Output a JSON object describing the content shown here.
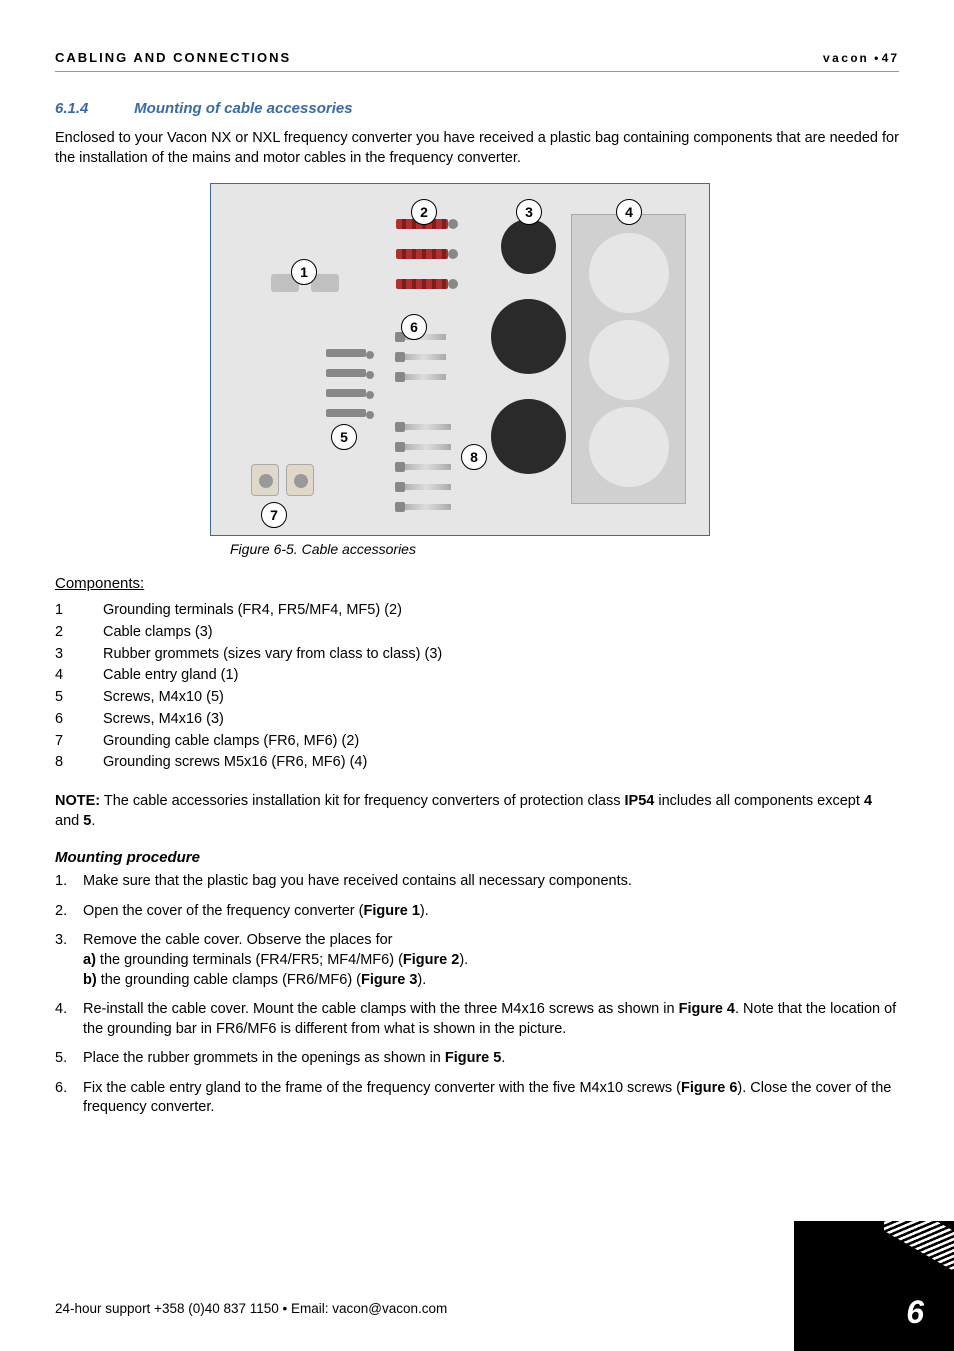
{
  "header": {
    "left": "CABLING AND CONNECTIONS",
    "right_brand": "vacon",
    "right_page": "47"
  },
  "section": {
    "number": "6.1.4",
    "title": "Mounting of cable accessories"
  },
  "intro": "Enclosed to your Vacon NX or NXL frequency converter you have received a plastic bag containing components that are needed for the installation of the mains and motor cables in the frequency converter.",
  "figure": {
    "caption": "Figure 6-5. Cable accessories",
    "callouts": [
      "1",
      "2",
      "3",
      "4",
      "5",
      "6",
      "7",
      "8"
    ]
  },
  "components": {
    "title": "Components:",
    "items": [
      {
        "num": "1",
        "text": "Grounding terminals (FR4, FR5/MF4, MF5) (2)"
      },
      {
        "num": "2",
        "text": "Cable clamps (3)"
      },
      {
        "num": "3",
        "text": "Rubber grommets (sizes vary from class to class) (3)"
      },
      {
        "num": "4",
        "text": "Cable entry gland (1)"
      },
      {
        "num": "5",
        "text": "Screws, M4x10 (5)"
      },
      {
        "num": "6",
        "text": "Screws, M4x16 (3)"
      },
      {
        "num": "7",
        "text": "Grounding cable clamps (FR6, MF6) (2)"
      },
      {
        "num": "8",
        "text": "Grounding screws M5x16 (FR6, MF6) (4)"
      }
    ]
  },
  "note": {
    "label": "NOTE:",
    "text_a": " The cable accessories installation kit for frequency converters of protection class ",
    "bold1": "IP54",
    "text_b": " includes all components except ",
    "bold2": "4",
    "text_c": " and ",
    "bold3": "5",
    "text_d": "."
  },
  "procedure": {
    "title": "Mounting procedure",
    "steps": [
      {
        "num": "1.",
        "text": "Make sure that the plastic bag you have received contains all necessary components."
      },
      {
        "num": "2.",
        "text_a": "Open the cover of the frequency converter (",
        "fig": "Figure 1",
        "text_b": ")."
      },
      {
        "num": "3.",
        "text": "Remove the cable cover. Observe the places for",
        "sub_a_label": "a)",
        "sub_a_text": " the grounding terminals (FR4/FR5; MF4/MF6) (",
        "sub_a_fig": "Figure 2",
        "sub_a_end": ").",
        "sub_b_label": "b)",
        "sub_b_text": " the grounding cable clamps (FR6/MF6) (",
        "sub_b_fig": "Figure 3",
        "sub_b_end": ")."
      },
      {
        "num": "4.",
        "text_a": "Re-install the cable cover. Mount the cable clamps with the three M4x16 screws as shown in ",
        "fig": "Figure 4",
        "text_b": ". Note that the location of the grounding bar in FR6/MF6 is different from what is shown in the picture."
      },
      {
        "num": "5.",
        "text_a": "Place the rubber grommets in the openings as shown in ",
        "fig": "Figure 5",
        "text_b": "."
      },
      {
        "num": "6.",
        "text_a": "Fix the cable entry gland to the frame of the frequency converter with the five M4x10 screws (",
        "fig": "Figure 6",
        "text_b": "). Close the cover of the frequency converter."
      }
    ]
  },
  "footer": {
    "text": "24-hour support +358 (0)40 837 1150 • Email: vacon@vacon.com",
    "page_num": "6"
  }
}
